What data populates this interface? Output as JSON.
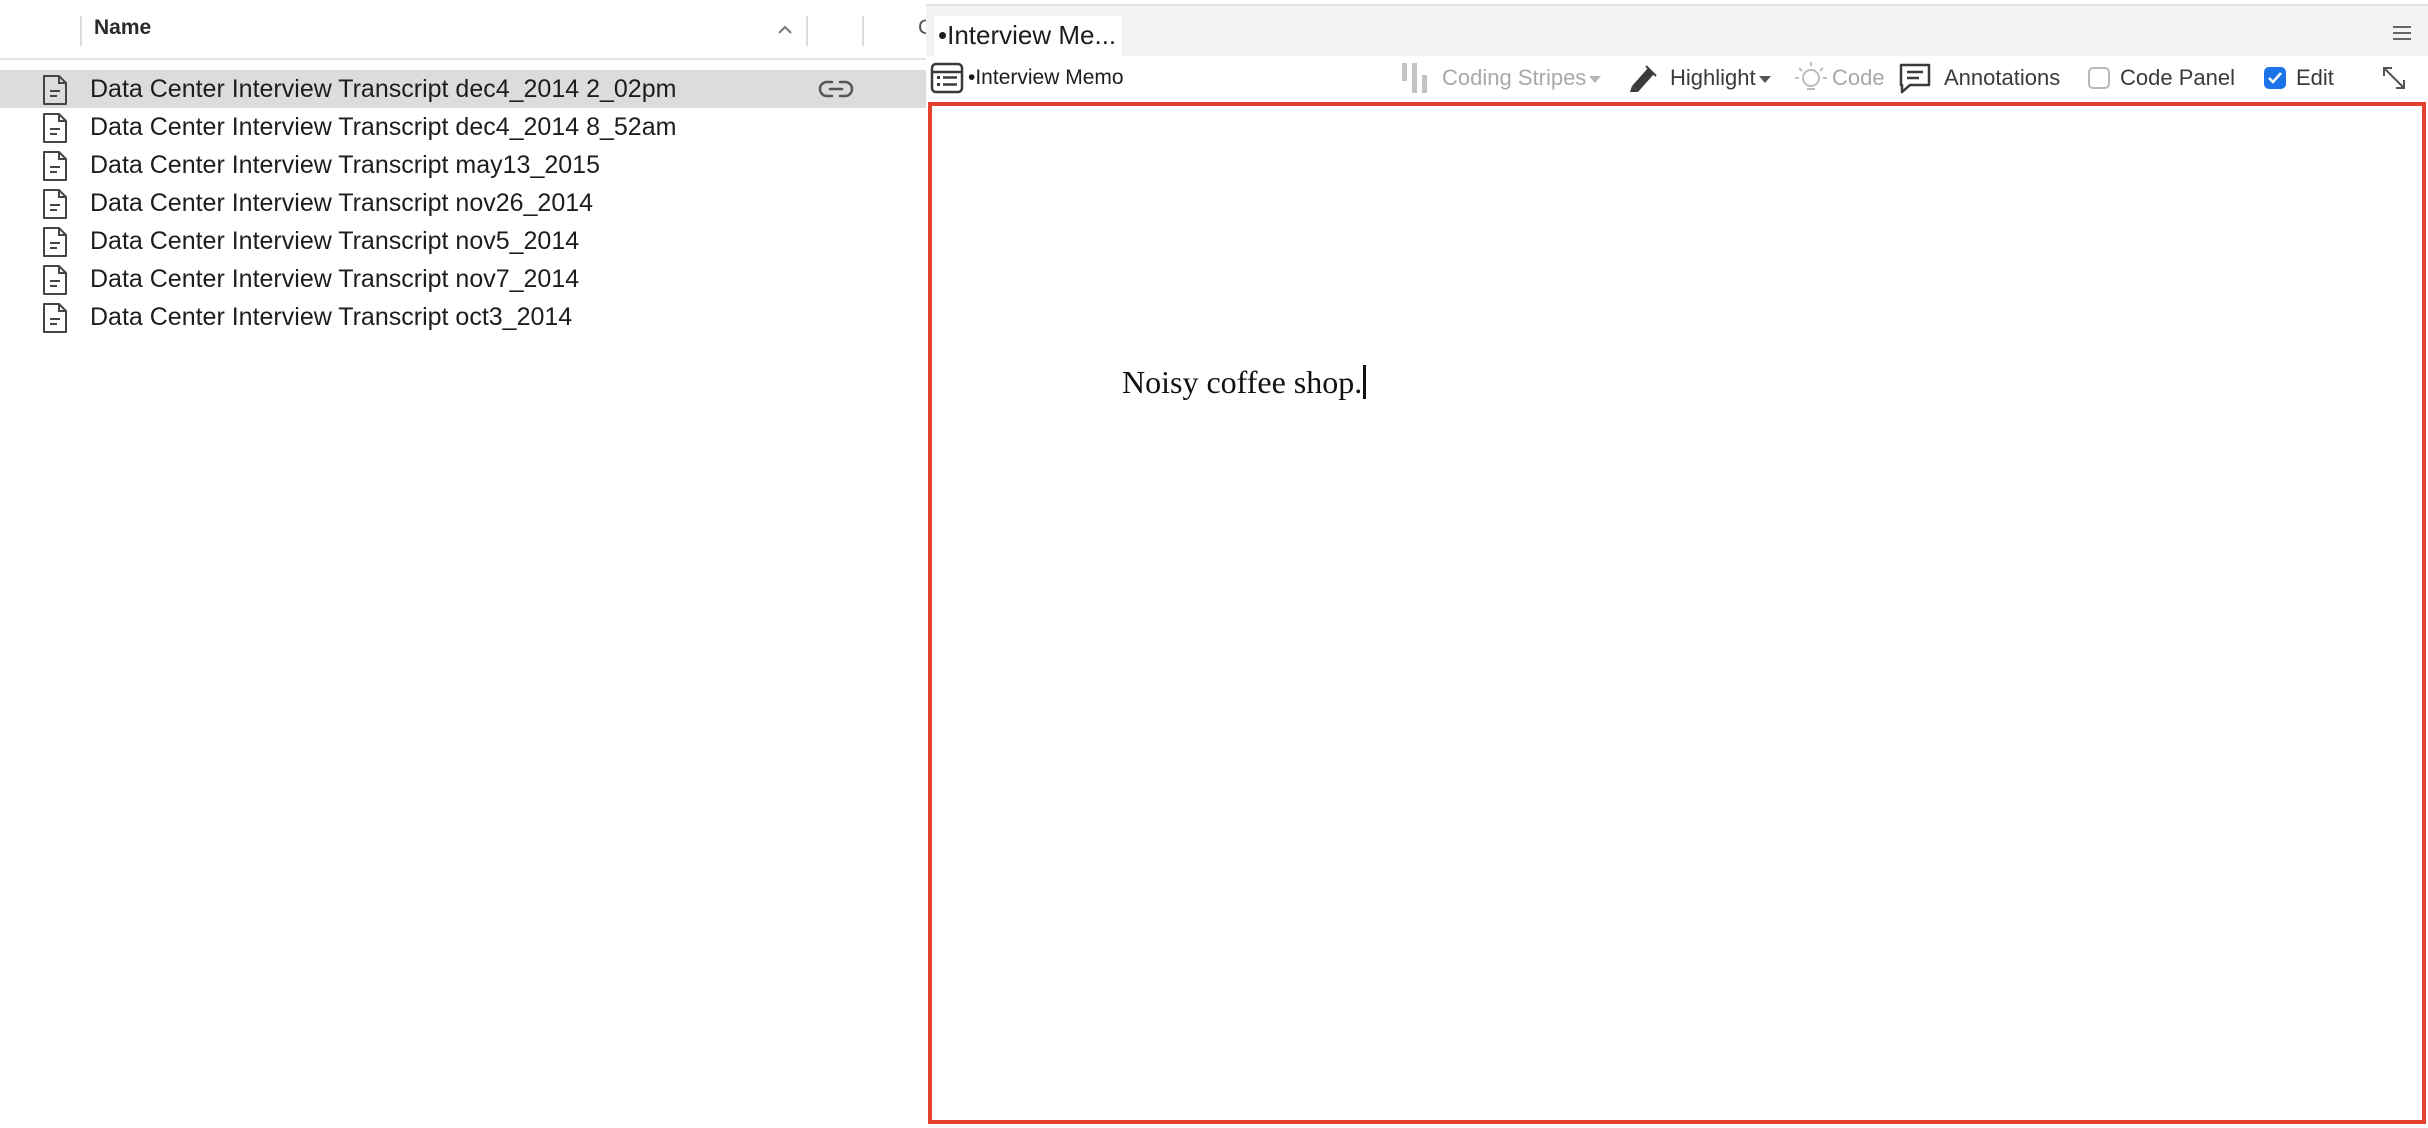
{
  "file_list": {
    "header": {
      "name_label": "Name",
      "extra_column_label": "C"
    },
    "files": [
      {
        "label": "Data Center Interview Transcript dec4_2014 2_02pm",
        "selected": true,
        "linked": true
      },
      {
        "label": "Data Center Interview Transcript dec4_2014 8_52am",
        "selected": false,
        "linked": false
      },
      {
        "label": "Data Center Interview Transcript may13_2015",
        "selected": false,
        "linked": false
      },
      {
        "label": "Data Center Interview Transcript nov26_2014",
        "selected": false,
        "linked": false
      },
      {
        "label": "Data Center Interview Transcript nov5_2014",
        "selected": false,
        "linked": false
      },
      {
        "label": "Data Center Interview Transcript nov7_2014",
        "selected": false,
        "linked": false
      },
      {
        "label": "Data Center Interview Transcript oct3_2014",
        "selected": false,
        "linked": false
      }
    ]
  },
  "memo_panel": {
    "tab_title": "•Interview Me...",
    "document_name": "•Interview Memo",
    "toolbar": {
      "coding_stripes_label": "Coding Stripes",
      "highlight_label": "Highlight",
      "code_label": "Code",
      "annotations_label": "Annotations",
      "code_panel_label": "Code Panel",
      "code_panel_checked": false,
      "edit_label": "Edit",
      "edit_checked": true
    },
    "editor": {
      "text": "Noisy coffee shop."
    }
  },
  "colors": {
    "accent": "#1a73e8",
    "editor_border": "#e4402f",
    "selected_row": "#dcdcdc"
  }
}
